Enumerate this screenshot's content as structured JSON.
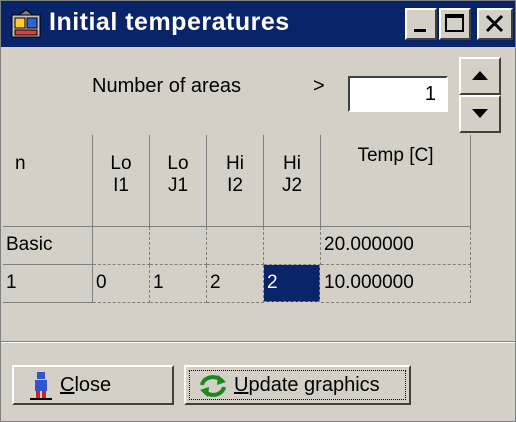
{
  "window": {
    "title": "Initial temperatures",
    "controls": [
      "minimize",
      "maximize",
      "close"
    ]
  },
  "areas": {
    "label": "Number of areas",
    "arrow": ">",
    "value": "1"
  },
  "table": {
    "headers": [
      {
        "line1": "n",
        "line2": ""
      },
      {
        "line1": "Lo",
        "line2": "I1"
      },
      {
        "line1": "Lo",
        "line2": "J1"
      },
      {
        "line1": "Hi",
        "line2": "I2"
      },
      {
        "line1": "Hi",
        "line2": "J2"
      },
      {
        "line1": "Temp  [C]",
        "line2": ""
      }
    ],
    "rows": [
      {
        "n": "Basic",
        "lo_i1": "",
        "lo_j1": "",
        "hi_i2": "",
        "hi_j2": "",
        "temp": "20.000000"
      },
      {
        "n": "1",
        "lo_i1": "0",
        "lo_j1": "1",
        "hi_i2": "2",
        "hi_j2": "2",
        "temp": "10.000000"
      }
    ],
    "selected_cell": "rows.1.hi_j2"
  },
  "buttons": {
    "close": {
      "prefix": "",
      "mnemonic": "C",
      "rest": "lose",
      "icon": "figure-icon"
    },
    "update": {
      "prefix": "",
      "mnemonic": "U",
      "rest": "pdate graphics",
      "icon": "refresh-icon"
    }
  },
  "colors": {
    "titlebar": "#0a246a",
    "face": "#d4d0c8",
    "selection": "#0a246a"
  }
}
